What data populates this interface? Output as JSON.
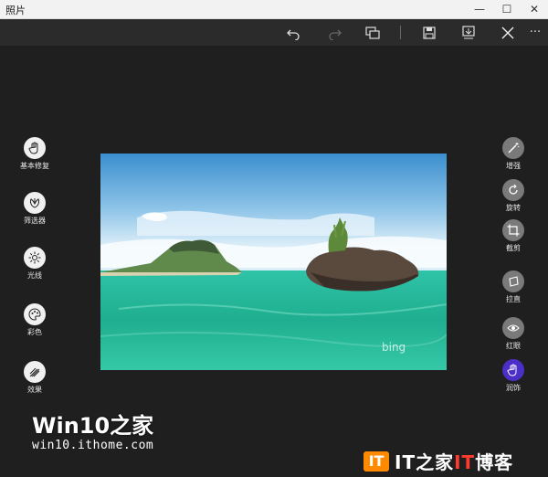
{
  "window": {
    "title": "照片"
  },
  "window_controls": {
    "minimize": "—",
    "maximize": "☐",
    "close": "✕"
  },
  "toolbar": {
    "items": [
      "undo-icon",
      "redo-icon",
      "compare-icon",
      "save-icon",
      "save-copy-icon",
      "cancel-icon",
      "more-icon"
    ],
    "more_label": "···"
  },
  "left_tools": [
    {
      "label": "基本修复",
      "icon": "hand-icon",
      "active": true
    },
    {
      "label": "筛选器",
      "icon": "filter-icon"
    },
    {
      "label": "光线",
      "icon": "sun-icon"
    },
    {
      "label": "彩色",
      "icon": "palette-icon"
    },
    {
      "label": "效果",
      "icon": "effects-icon"
    }
  ],
  "right_tools": [
    {
      "label": "增强",
      "icon": "wand-icon"
    },
    {
      "label": "旋转",
      "icon": "rotate-icon"
    },
    {
      "label": "截剪",
      "icon": "crop-icon"
    },
    {
      "label": "拉直",
      "icon": "straighten-icon"
    },
    {
      "label": "红眼",
      "icon": "eye-icon"
    },
    {
      "label": "润饰",
      "icon": "retouch-icon",
      "active": true
    }
  ],
  "photo": {
    "watermark": "bing"
  },
  "watermarks": {
    "win10_title": "Win10之家",
    "win10_url": "win10.ithome.com",
    "it_mark": "IT",
    "it_text_a": "IT之家",
    "it_text_b": "IT",
    "it_text_c": "博客"
  },
  "colors": {
    "accent": "#4b2fc7",
    "background": "#1f1f1f",
    "toolbar": "#2b2b2b"
  }
}
